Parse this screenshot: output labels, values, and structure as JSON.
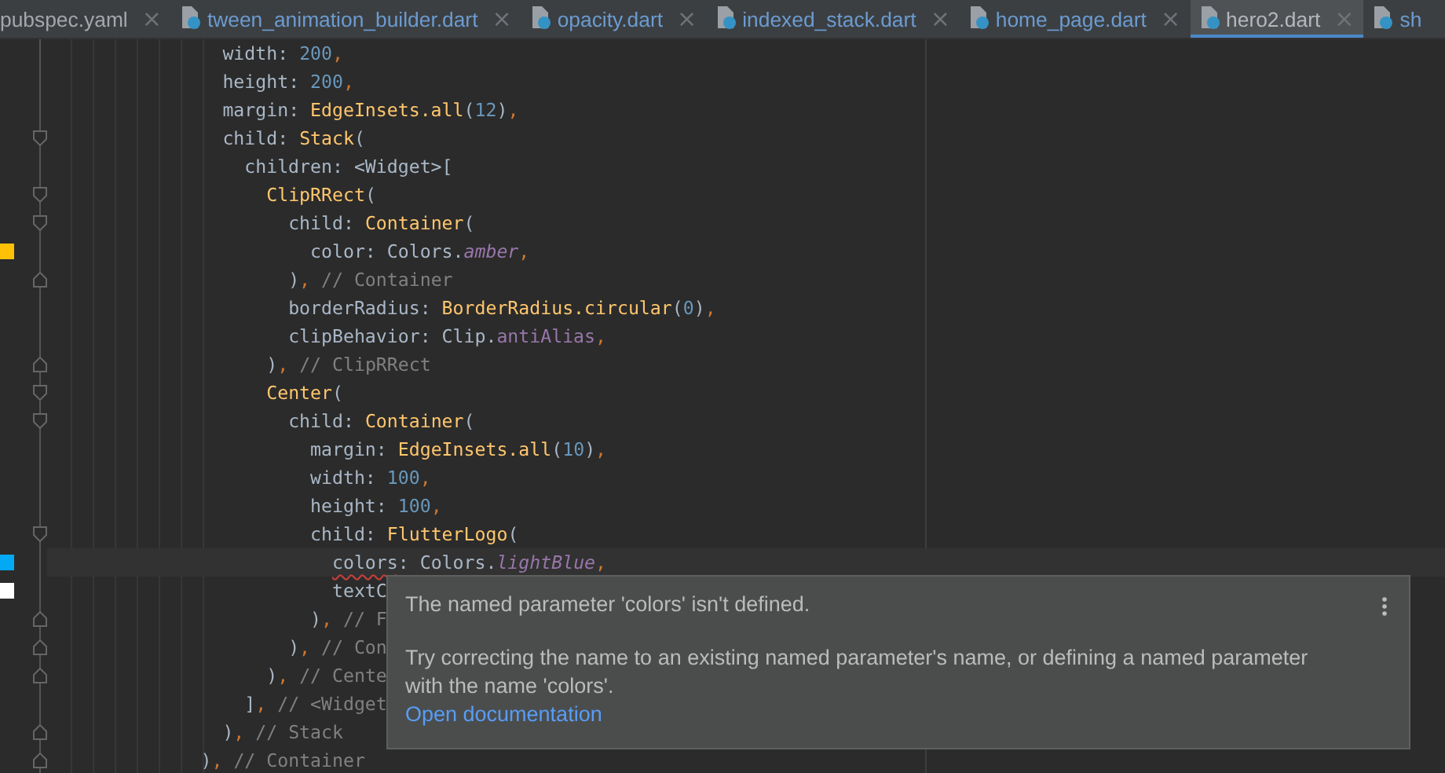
{
  "tabs": [
    {
      "label": "pubspec.yaml",
      "icon": false,
      "color": "#a4a8ad",
      "selected": false
    },
    {
      "label": "tween_animation_builder.dart",
      "icon": true,
      "color": "#6b9bd1",
      "selected": false
    },
    {
      "label": "opacity.dart",
      "icon": true,
      "color": "#6b9bd1",
      "selected": false
    },
    {
      "label": "indexed_stack.dart",
      "icon": true,
      "color": "#6b9bd1",
      "selected": false
    },
    {
      "label": "home_page.dart",
      "icon": true,
      "color": "#6b9bd1",
      "selected": false
    },
    {
      "label": "hero2.dart",
      "icon": true,
      "color": "#b4b8bd",
      "selected": true
    },
    {
      "label": "sh",
      "icon": true,
      "color": "#6b9bd1",
      "selected": false,
      "cut": true
    }
  ],
  "close_glyph": "×",
  "lines": [
    {
      "kind": "plain",
      "tokens": [
        {
          "text": "                width: ",
          "kind": "plain"
        },
        {
          "text": "200",
          "kind": "number"
        },
        {
          "text": ",",
          "kind": "punct"
        }
      ]
    },
    {
      "kind": "plain",
      "tokens": [
        {
          "text": "                height: ",
          "kind": "plain"
        },
        {
          "text": "200",
          "kind": "number"
        },
        {
          "text": ",",
          "kind": "punct"
        }
      ]
    },
    {
      "kind": "plain",
      "tokens": [
        {
          "text": "                margin: ",
          "kind": "plain"
        },
        {
          "text": "EdgeInsets.all",
          "kind": "class"
        },
        {
          "text": "(",
          "kind": "plain"
        },
        {
          "text": "12",
          "kind": "number"
        },
        {
          "text": ")",
          "kind": "plain"
        },
        {
          "text": ",",
          "kind": "punct"
        }
      ]
    },
    {
      "kind": "opener",
      "tokens": [
        {
          "text": "                child: ",
          "kind": "plain"
        },
        {
          "text": "Stack",
          "kind": "class"
        },
        {
          "text": "(",
          "kind": "plain"
        }
      ]
    },
    {
      "kind": "plain",
      "tokens": [
        {
          "text": "                  children: <Widget>[",
          "kind": "plain"
        }
      ]
    },
    {
      "kind": "opener",
      "tokens": [
        {
          "text": "                    ClipRRect",
          "kind": "class"
        },
        {
          "text": "(",
          "kind": "plain"
        }
      ]
    },
    {
      "kind": "opener",
      "tokens": [
        {
          "text": "                      child: ",
          "kind": "plain"
        },
        {
          "text": "Container",
          "kind": "class"
        },
        {
          "text": "(",
          "kind": "plain"
        }
      ]
    },
    {
      "kind": "plain",
      "color": "#ffc107",
      "tokens": [
        {
          "text": "                        color: Colors.",
          "kind": "plain"
        },
        {
          "text": "amber",
          "kind": "constant"
        },
        {
          "text": ",",
          "kind": "punct"
        }
      ]
    },
    {
      "kind": "closer",
      "tokens": [
        {
          "text": "                      )",
          "kind": "plain"
        },
        {
          "text": ",",
          "kind": "punct"
        },
        {
          "text": " // Container",
          "kind": "comment"
        }
      ]
    },
    {
      "kind": "plain",
      "tokens": [
        {
          "text": "                      borderRadius: ",
          "kind": "plain"
        },
        {
          "text": "BorderRadius.circular",
          "kind": "class"
        },
        {
          "text": "(",
          "kind": "plain"
        },
        {
          "text": "0",
          "kind": "number"
        },
        {
          "text": ")",
          "kind": "plain"
        },
        {
          "text": ",",
          "kind": "punct"
        }
      ]
    },
    {
      "kind": "plain",
      "tokens": [
        {
          "text": "                      clipBehavior: Clip.",
          "kind": "plain"
        },
        {
          "text": "antiAlias",
          "kind": "enum"
        },
        {
          "text": ",",
          "kind": "punct"
        }
      ]
    },
    {
      "kind": "closer",
      "tokens": [
        {
          "text": "                    )",
          "kind": "plain"
        },
        {
          "text": ",",
          "kind": "punct"
        },
        {
          "text": " // ClipRRect",
          "kind": "comment"
        }
      ]
    },
    {
      "kind": "opener",
      "tokens": [
        {
          "text": "                    Center",
          "kind": "class"
        },
        {
          "text": "(",
          "kind": "plain"
        }
      ]
    },
    {
      "kind": "opener",
      "tokens": [
        {
          "text": "                      child: ",
          "kind": "plain"
        },
        {
          "text": "Container",
          "kind": "class"
        },
        {
          "text": "(",
          "kind": "plain"
        }
      ]
    },
    {
      "kind": "plain",
      "tokens": [
        {
          "text": "                        margin: ",
          "kind": "plain"
        },
        {
          "text": "EdgeInsets.all",
          "kind": "class"
        },
        {
          "text": "(",
          "kind": "plain"
        },
        {
          "text": "10",
          "kind": "number"
        },
        {
          "text": ")",
          "kind": "plain"
        },
        {
          "text": ",",
          "kind": "punct"
        }
      ]
    },
    {
      "kind": "plain",
      "tokens": [
        {
          "text": "                        width: ",
          "kind": "plain"
        },
        {
          "text": "100",
          "kind": "number"
        },
        {
          "text": ",",
          "kind": "punct"
        }
      ]
    },
    {
      "kind": "plain",
      "tokens": [
        {
          "text": "                        height: ",
          "kind": "plain"
        },
        {
          "text": "100",
          "kind": "number"
        },
        {
          "text": ",",
          "kind": "punct"
        }
      ]
    },
    {
      "kind": "opener",
      "tokens": [
        {
          "text": "                        child: ",
          "kind": "plain"
        },
        {
          "text": "FlutterLogo",
          "kind": "class"
        },
        {
          "text": "(",
          "kind": "plain"
        }
      ]
    },
    {
      "kind": "plain",
      "color": "#03a9f4",
      "current": true,
      "tokens": [
        {
          "text": "                          colors",
          "kind": "error"
        },
        {
          "text": ": Colors.",
          "kind": "plain"
        },
        {
          "text": "lightBlue",
          "kind": "constant"
        },
        {
          "text": ",",
          "kind": "punct"
        }
      ]
    },
    {
      "kind": "plain",
      "color": "#ffffff",
      "tokens": [
        {
          "text": "                          textC",
          "kind": "plain"
        }
      ]
    },
    {
      "kind": "closer",
      "tokens": [
        {
          "text": "                        )",
          "kind": "plain"
        },
        {
          "text": ",",
          "kind": "punct"
        },
        {
          "text": " // F",
          "kind": "comment"
        }
      ]
    },
    {
      "kind": "closer",
      "tokens": [
        {
          "text": "                      )",
          "kind": "plain"
        },
        {
          "text": ",",
          "kind": "punct"
        },
        {
          "text": " // Con",
          "kind": "comment"
        }
      ]
    },
    {
      "kind": "closer",
      "tokens": [
        {
          "text": "                    )",
          "kind": "plain"
        },
        {
          "text": ",",
          "kind": "punct"
        },
        {
          "text": " // Cente",
          "kind": "comment"
        }
      ]
    },
    {
      "kind": "plain",
      "tokens": [
        {
          "text": "                  ]",
          "kind": "plain"
        },
        {
          "text": ",",
          "kind": "punct"
        },
        {
          "text": " // <Widget",
          "kind": "comment"
        }
      ]
    },
    {
      "kind": "closer",
      "tokens": [
        {
          "text": "                )",
          "kind": "plain"
        },
        {
          "text": ",",
          "kind": "punct"
        },
        {
          "text": " // Stack",
          "kind": "comment"
        }
      ]
    },
    {
      "kind": "closer",
      "tokens": [
        {
          "text": "              )",
          "kind": "plain"
        },
        {
          "text": ",",
          "kind": "punct"
        },
        {
          "text": " // Container",
          "kind": "comment"
        }
      ]
    }
  ],
  "tooltip": {
    "title": "The named parameter 'colors' isn't defined.",
    "body": "Try correcting the name to an existing named parameter's name, or defining a named parameter with the name 'colors'.",
    "link": "Open documentation"
  }
}
